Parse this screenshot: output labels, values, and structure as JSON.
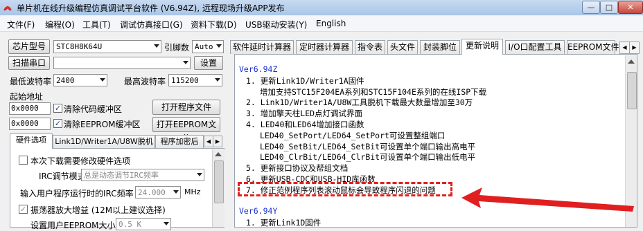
{
  "window": {
    "title": "单片机在线升级编程仿真调试平台软件 (V6.94Z), 远程现场升级APP发布",
    "min_label": "—",
    "max_label": "□",
    "close_label": "✕"
  },
  "menu": [
    "文件(F)",
    "编程(O)",
    "工具(T)",
    "调试仿真接口(G)",
    "资料下载(D)",
    "USB驱动安装(Y)",
    "English"
  ],
  "left": {
    "chip_button": "芯片型号",
    "chip_value": "STC8H8K64U",
    "pin_label": "引脚数",
    "pin_value": "Auto",
    "scan_button": "扫描串口",
    "port_value": "",
    "settings_button": "设置",
    "min_baud_label": "最低波特率",
    "min_baud_value": "2400",
    "max_baud_label": "最高波特率",
    "max_baud_value": "115200",
    "start_addr_label": "起始地址",
    "code_addr": "0x0000",
    "clear_code_label": "清除代码缓冲区",
    "open_program_button": "打开程序文件",
    "eeprom_addr": "0x0000",
    "clear_eeprom_label": "清除EEPROM缓冲区",
    "open_eeprom_button": "打开EEPROM文件",
    "tabs": [
      "硬件选项",
      "Link1D/Writer1A/U8W脱机",
      "程序加密后"
    ],
    "hw": {
      "modify_option_label": "本次下载需要修改硬件选项",
      "irc_mode_label": "IRC调节模式",
      "irc_mode_value": "总是动态调节IRC频率",
      "input_freq_label": "输入用户程序运行时的IRC频率",
      "input_freq_value": "24.000",
      "freq_unit": "MHz",
      "osc_gain_label": "振荡器放大增益 (12M以上建议选择)",
      "eeprom_size_label": "设置用户EEPROM大小",
      "eeprom_size_value": "0.5 K"
    }
  },
  "right": {
    "tabs": [
      "软件延时计算器",
      "定时器计算器",
      "指令表",
      "头文件",
      "封装脚位",
      "更新说明",
      "I/O口配置工具",
      "EEPROM文件"
    ],
    "active_tab_index": 5,
    "doc_lines": [
      {
        "text": "Ver6.94Z",
        "indent": 0,
        "version": true
      },
      {
        "text": "1. 更新Link1D/Writer1A固件",
        "indent": 1
      },
      {
        "text": "增加支持STC15F204EA系列和STC15F104E系列的在线ISP下载",
        "indent": 2
      },
      {
        "text": "2. Link1D/Writer1A/U8W工具脱机下载最大数量增加至30万",
        "indent": 1
      },
      {
        "text": "3. 增加擎天柱LED点灯调试界面",
        "indent": 1
      },
      {
        "text": "4. LED40和LED64增加接口函数",
        "indent": 1
      },
      {
        "text": "LED40_SetPort/LED64_SetPort可设置整组端口",
        "indent": 2
      },
      {
        "text": "LED40_SetBit/LED64_SetBit可设置单个端口输出高电平",
        "indent": 2
      },
      {
        "text": "LED40_ClrBit/LED64_ClrBit可设置单个端口输出低电平",
        "indent": 2
      },
      {
        "text": "5. 更新接口协议及帮组文档",
        "indent": 1
      },
      {
        "text": "6. 更新USB-CDC和USB-HID库函数",
        "indent": 1
      },
      {
        "text": "7. 修正范例程序列表滚动鼠标会导致程序闪退的问题",
        "indent": 1
      },
      {
        "text": "",
        "indent": 0
      },
      {
        "text": "Ver6.94Y",
        "indent": 0,
        "version": true
      },
      {
        "text": "1. 更新Link1D固件",
        "indent": 1
      }
    ],
    "highlight_line_index": 11,
    "highlight_color": "#e02020"
  }
}
